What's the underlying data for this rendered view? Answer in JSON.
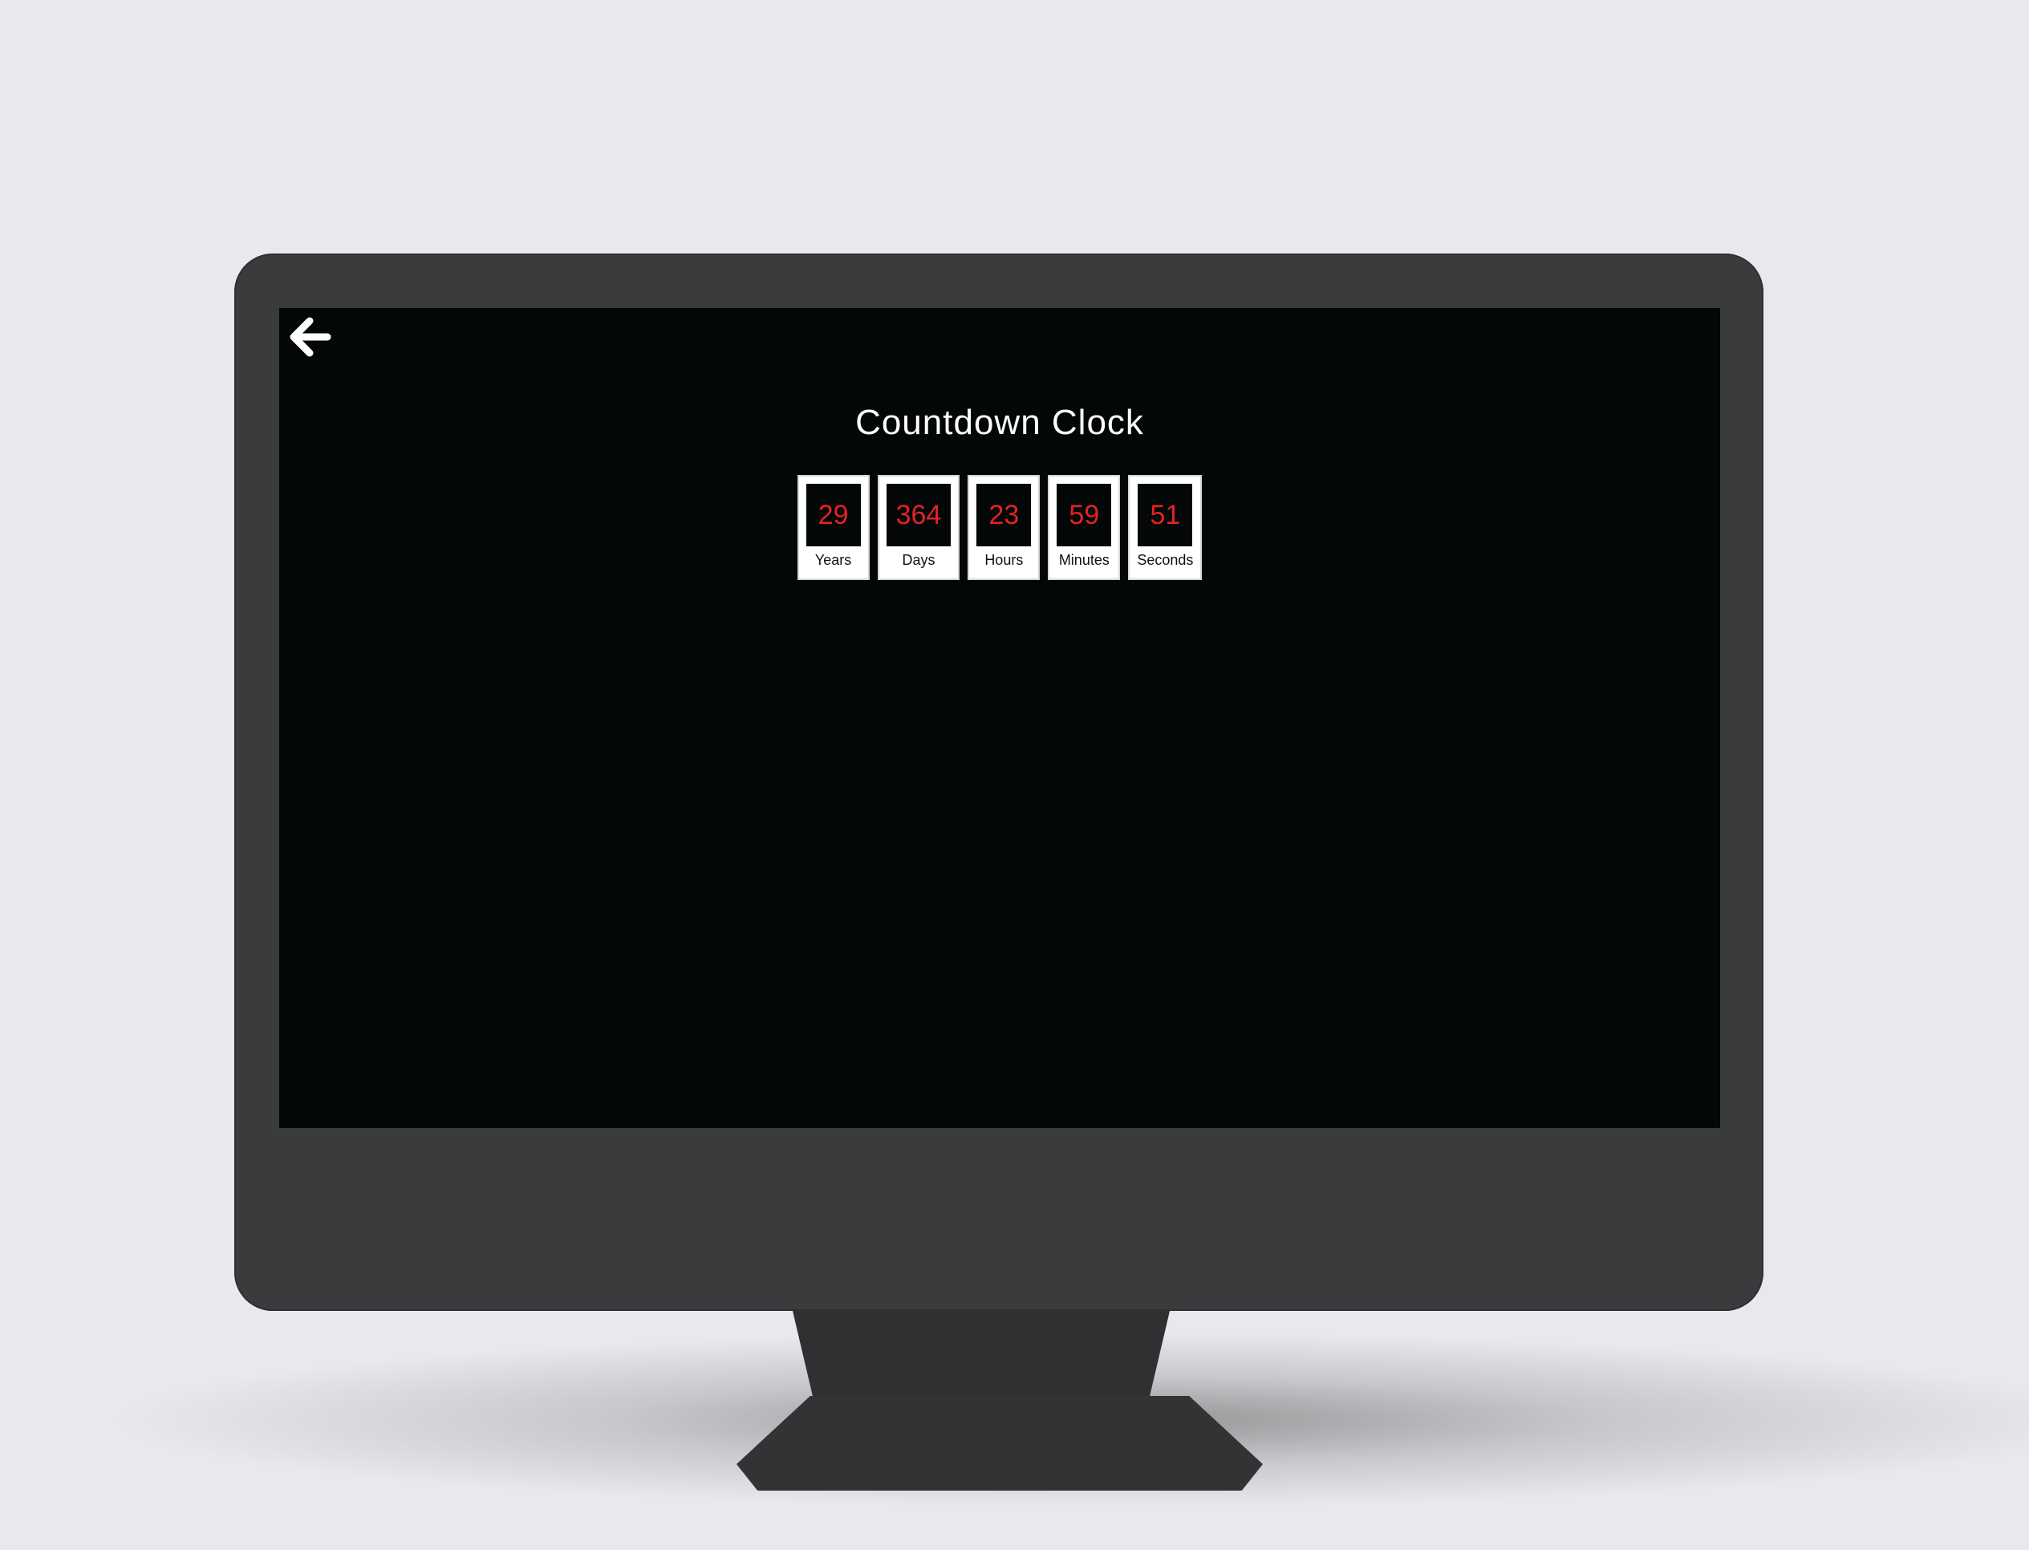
{
  "page": {
    "title": "Countdown Clock"
  },
  "nav": {
    "back_icon": "arrow-left-icon"
  },
  "countdown": [
    {
      "value": "29",
      "unit": "Years"
    },
    {
      "value": "364",
      "unit": "Days"
    },
    {
      "value": "23",
      "unit": "Hours"
    },
    {
      "value": "59",
      "unit": "Minutes"
    },
    {
      "value": "51",
      "unit": "Seconds"
    }
  ],
  "colors": {
    "screen_bg": "#040708",
    "digit_color": "#e32224",
    "card_bg": "#ffffff",
    "bezel": "#3a3b3c"
  }
}
